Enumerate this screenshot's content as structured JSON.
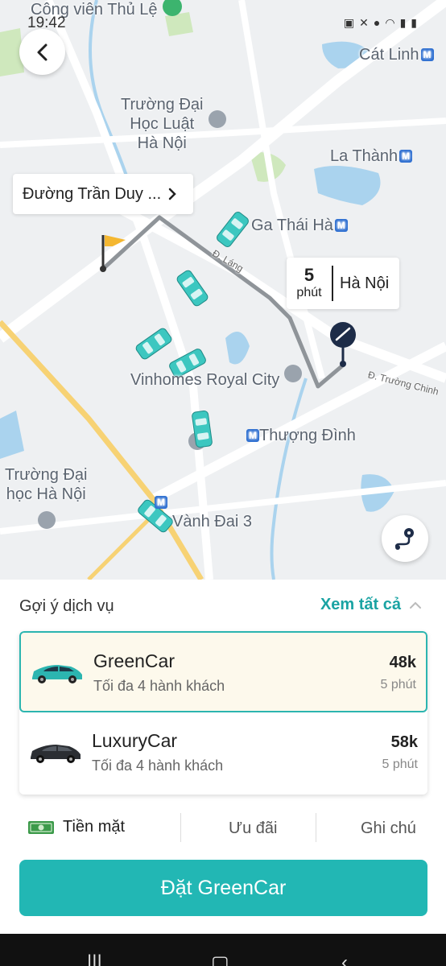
{
  "status_bar": {
    "time": "19:42"
  },
  "map": {
    "labels": {
      "cong_vien": "Công viên Thủ Lệ",
      "cat_linh": "Cát Linh",
      "truong_luat": "Trường Đại\nHọc Luật\nHà Nội",
      "la_thanh": "La Thành",
      "ga_thai_ha": "Ga Thái Hà",
      "d_lang": "Đ. Láng",
      "vinhomes": "Vinhomes Royal City",
      "d_truong_chinh": "Đ. Trường Chinh",
      "thuong_dinh": "Thượng Đình",
      "truong_dh_hn": "Trường Đại\nhọc Hà Nội",
      "vanh_dai_3": "Vành Đai 3",
      "metro_letter": "M"
    },
    "destination": "Đường Trần Duy ...",
    "eta": {
      "value": "5",
      "unit": "phút",
      "city": "Hà Nội"
    },
    "colors": {
      "route": "#8f9499",
      "taxi": "#3cc7c0",
      "road": "#ffffff",
      "major_road": "#f7d274",
      "water": "#aad3ee",
      "park": "#cfe8bd"
    }
  },
  "panel": {
    "title": "Gợi ý dịch vụ",
    "see_all": "Xem tất cả",
    "services": [
      {
        "name": "GreenCar",
        "capacity": "Tối đa 4 hành khách",
        "price": "48k",
        "time": "5 phút",
        "selected": true
      },
      {
        "name": "LuxuryCar",
        "capacity": "Tối đa 4 hành khách",
        "price": "58k",
        "time": "5 phút",
        "selected": false
      }
    ],
    "payment": "Tiền mặt",
    "promo": "Ưu đãi",
    "note": "Ghi chú",
    "book_button": "Đặt GreenCar",
    "accent": "#22b7b4"
  }
}
